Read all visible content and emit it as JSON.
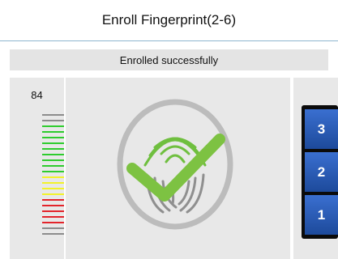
{
  "header": {
    "title": "Enroll Fingerprint(2-6)"
  },
  "status": {
    "message": "Enrolled successfully"
  },
  "quality": {
    "score": "84",
    "bars": [
      "gray",
      "gray",
      "green",
      "green",
      "green",
      "green",
      "green",
      "green",
      "green",
      "green",
      "green",
      "yellow",
      "yellow",
      "yellow",
      "yellow",
      "red",
      "red",
      "red",
      "red",
      "red",
      "gray",
      "gray"
    ]
  },
  "steps": {
    "labels": [
      "3",
      "2",
      "1"
    ]
  },
  "colors": {
    "gray": "#8c8c8c",
    "green": "#2ecc2e",
    "yellow": "#f2f22a",
    "red": "#e3242b",
    "check": "#7dc242",
    "ring": "#bcbcbc"
  }
}
